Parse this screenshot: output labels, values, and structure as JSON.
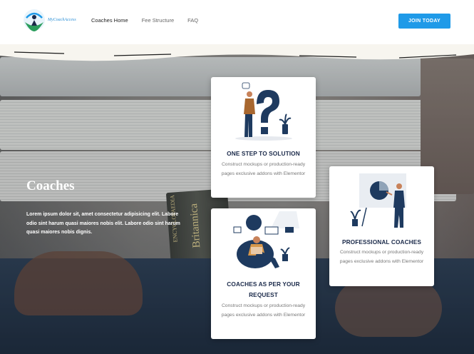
{
  "header": {
    "logo_text": "MyCoachAccess",
    "nav": [
      {
        "label": "Coaches Home"
      },
      {
        "label": "Fee Structure"
      },
      {
        "label": "FAQ"
      }
    ],
    "cta_label": "JOIN TODAY"
  },
  "hero": {
    "title": "Coaches",
    "body": "Lorem ipsum dolor sit, amet consectetur adipisicing elit. Labore odio sint harum quasi maiores nobis elit. Labore odio sint harum quasi maiores nobis dignis.",
    "book_spine_text": "ENCYCLOPAEDIA",
    "book_spine_title": "Britannica"
  },
  "cards": [
    {
      "title": "ONE STEP TO SOLUTION",
      "desc": "Construct mockups or production-ready pages exclusive addons with Elementor"
    },
    {
      "title": "COACHES AS PER YOUR REQUEST",
      "desc": "Construct mockups or production-ready pages exclusive addons with Elementor"
    },
    {
      "title": "PROFESSIONAL COACHES",
      "desc": "Construct mockups or production-ready pages exclusive addons with Elementor"
    }
  ],
  "colors": {
    "accent": "#1f9ae8",
    "title": "#1b2a4a",
    "illustration": "#1e3a5f"
  },
  "icons": [
    "logo-icon",
    "question-mark-illustration",
    "reading-person-illustration",
    "presentation-illustration"
  ]
}
